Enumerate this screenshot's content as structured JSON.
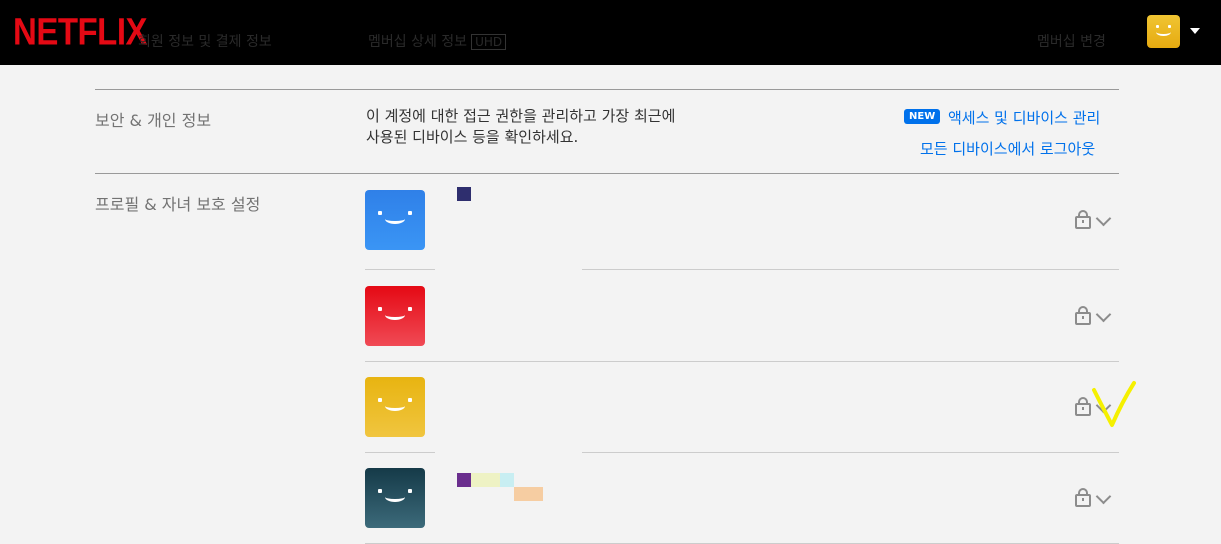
{
  "header": {
    "logo": "NETFLIX",
    "ghost_left": "회원 정보 및 결제 정보",
    "ghost_plan": "멤버십 상세 정보",
    "ghost_plan_badge": "UHD",
    "ghost_right": "멤버십 변경"
  },
  "security": {
    "title": "보안 & 개인 정보",
    "description_line1": "이 계정에 대한 접근 권한을 관리하고 가장 최근에",
    "description_line2": "사용된 디바이스 등을 확인하세요.",
    "new_badge": "NEW",
    "manage_link": "액세스 및 디바이스 관리",
    "signout_link": "모든 디바이스에서 로그아웃"
  },
  "profiles": {
    "title": "프로필 & 자녀 보호 설정",
    "items": [
      {
        "avatar_color": "#2f80e8"
      },
      {
        "avatar_color": "#e50914"
      },
      {
        "avatar_color": "#e8b411"
      },
      {
        "avatar_color": "#1a4a5a"
      }
    ]
  },
  "colors": {
    "accent": "#0071eb",
    "brand": "#e50914",
    "annotation": "#f5f000"
  }
}
